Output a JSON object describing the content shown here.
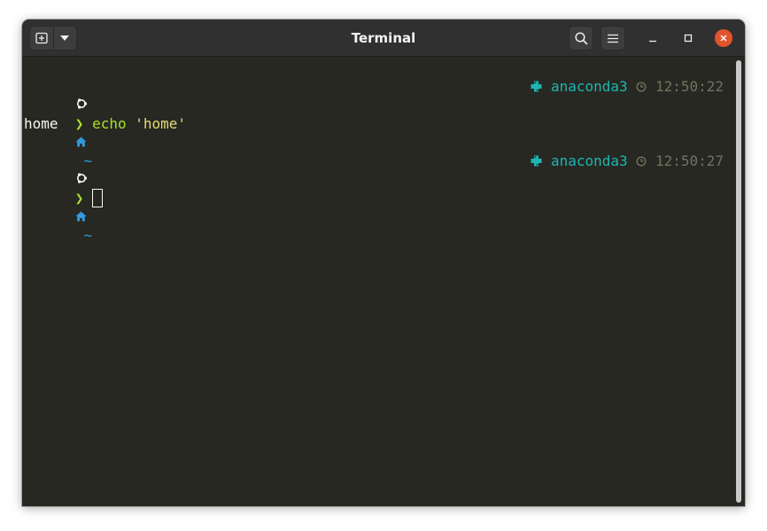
{
  "window": {
    "title": "Terminal"
  },
  "terminal": {
    "prompts": [
      {
        "dir_symbol": "~",
        "env": "anaconda3",
        "time": "12:50:22",
        "prompt_char": "❯",
        "cmd_name": "echo",
        "cmd_arg": "'home'"
      },
      {
        "dir_symbol": "~",
        "env": "anaconda3",
        "time": "12:50:27",
        "prompt_char": "❯"
      }
    ],
    "output": "home"
  },
  "colors": {
    "background": "#272822",
    "titlebar": "#303030",
    "prompt_green": "#a6e22e",
    "string_yellow": "#e6db74",
    "dir_blue": "#3399dd",
    "env_teal": "#1fb5b0",
    "close_orange": "#e2542c"
  },
  "icons": {
    "new_tab": "new-tab-icon",
    "menu_dropdown": "chevron-down-icon",
    "search": "search-icon",
    "hamburger": "hamburger-menu-icon",
    "os_logo": "ubuntu-logo-icon",
    "home": "home-icon",
    "python": "python-icon",
    "clock": "clock-icon"
  }
}
